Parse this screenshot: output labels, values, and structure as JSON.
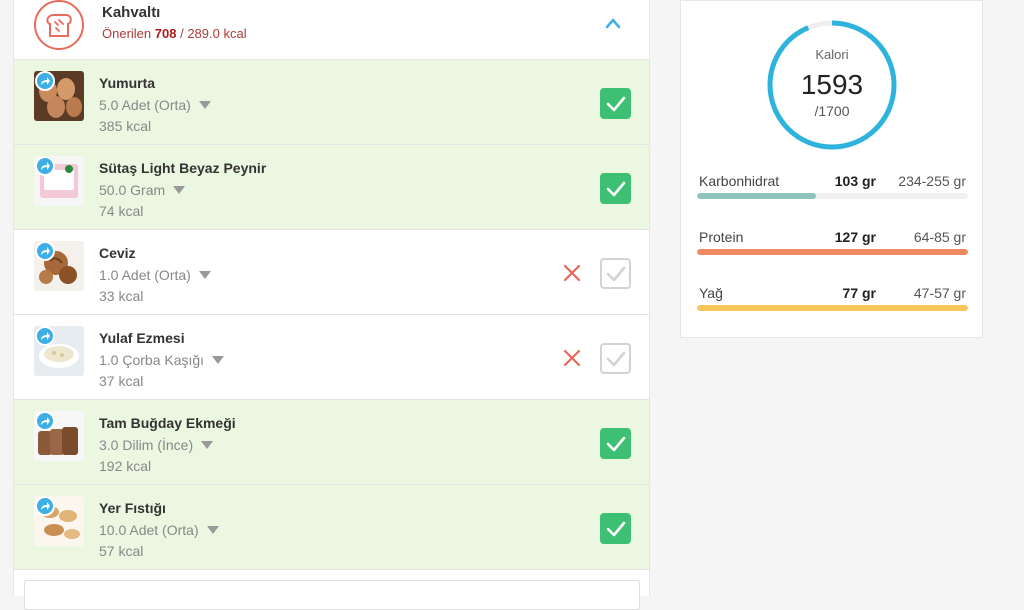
{
  "meal": {
    "title": "Kahvaltı",
    "recommended_label": "Önerilen",
    "recommended_value": "708",
    "recommended_suffix": "/ 289.0 kcal",
    "icon": "bread-icon",
    "collapse_icon": "chevron-up-icon"
  },
  "foods": [
    {
      "name": "Yumurta",
      "amount": "5.0 Adet (Orta)",
      "kcal": "385 kcal",
      "checked": true,
      "thumb": "eggs"
    },
    {
      "name": "Sütaş Light Beyaz Peynir",
      "amount": "50.0 Gram",
      "kcal": "74 kcal",
      "checked": true,
      "thumb": "cheese"
    },
    {
      "name": "Ceviz",
      "amount": "1.0 Adet (Orta)",
      "kcal": "33 kcal",
      "checked": false,
      "thumb": "walnut"
    },
    {
      "name": "Yulaf Ezmesi",
      "amount": "1.0 Çorba Kaşığı",
      "kcal": "37 kcal",
      "checked": false,
      "thumb": "oats"
    },
    {
      "name": "Tam Buğday Ekmeği",
      "amount": "3.0 Dilim (İnce)",
      "kcal": "192 kcal",
      "checked": true,
      "thumb": "bread"
    },
    {
      "name": "Yer Fıstığı",
      "amount": "10.0 Adet (Orta)",
      "kcal": "57 kcal",
      "checked": true,
      "thumb": "peanut"
    }
  ],
  "summary": {
    "calorie_label": "Kalori",
    "calorie_value": "1593",
    "calorie_goal": "/1700",
    "calorie_progress": 0.937,
    "ring_color": "#2eb3dc",
    "macros": [
      {
        "name": "Karbonhidrat",
        "value": "103 gr",
        "range": "234-255 gr",
        "progress": 0.44,
        "color": "#8ec3b9"
      },
      {
        "name": "Protein",
        "value": "127 gr",
        "range": "64-85 gr",
        "progress": 1.0,
        "color": "#ef8a60"
      },
      {
        "name": "Yağ",
        "value": "77 gr",
        "range": "47-57 gr",
        "progress": 1.0,
        "color": "#f5c75a"
      }
    ]
  },
  "colors": {
    "check_on": "#3dbf74",
    "remove": "#e8685a",
    "checked_row": "#ecf7e2"
  }
}
